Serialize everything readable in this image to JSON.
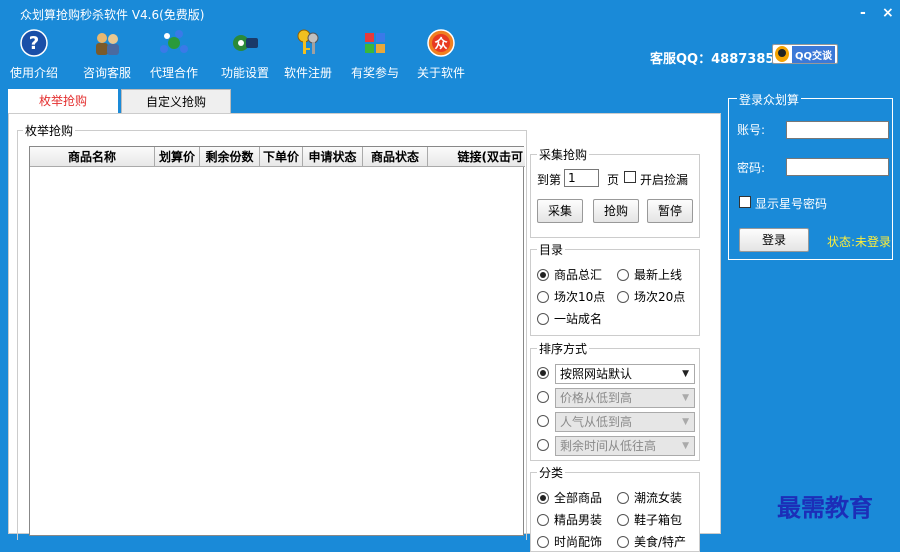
{
  "window": {
    "title": "众划算抢购秒杀软件 V4.6(免费版)",
    "minimize": "-",
    "close": "×"
  },
  "toolbar": [
    {
      "label": "使用介绍",
      "icon": "help-icon"
    },
    {
      "label": "咨询客服",
      "icon": "people-icon"
    },
    {
      "label": "代理合作",
      "icon": "network-icon"
    },
    {
      "label": "功能设置",
      "icon": "settings-icon"
    },
    {
      "label": "软件注册",
      "icon": "keys-icon"
    },
    {
      "label": "有奖参与",
      "icon": "gift-icon"
    },
    {
      "label": "关于软件",
      "icon": "about-icon"
    }
  ],
  "service": {
    "text": "客服QQ：488738580",
    "qq_button": "QQ交谈"
  },
  "tabs": [
    {
      "label": "枚举抢购"
    },
    {
      "label": "自定义抢购"
    }
  ],
  "enum_group": {
    "legend": "枚举抢购"
  },
  "grid": {
    "columns": [
      "商品名称",
      "划算价",
      "剩余份数",
      "下单价",
      "申请状态",
      "商品状态",
      "链接(双击可"
    ]
  },
  "collect": {
    "legend": "采集抢购",
    "page_prefix": "到第",
    "page_value": "1",
    "page_suffix": "页",
    "fill_label": "开启捡漏",
    "buttons": {
      "collect": "采集",
      "buy": "抢购",
      "pause": "暂停"
    }
  },
  "catalog": {
    "legend": "目录",
    "options": [
      "商品总汇",
      "最新上线",
      "场次10点",
      "场次20点",
      "一站成名"
    ],
    "selected": "商品总汇"
  },
  "sort": {
    "legend": "排序方式",
    "options": [
      "按照网站默认",
      "价格从低到高",
      "人气从低到高",
      "剩余时间从低往高"
    ],
    "selected": "按照网站默认"
  },
  "category": {
    "legend": "分类",
    "options": [
      "全部商品",
      "潮流女装",
      "精品男装",
      "鞋子箱包",
      "时尚配饰",
      "美食/特产"
    ],
    "selected": "全部商品"
  },
  "login": {
    "legend": "登录众划算",
    "account_label": "账号:",
    "password_label": "密码:",
    "show_password_label": "显示星号密码",
    "login_button": "登录",
    "status": "状态:未登录"
  },
  "watermark": "最需教育",
  "colors": {
    "accent": "#1a8ad8",
    "tab_active_text": "#e43030",
    "status_text": "#ffef3a",
    "watermark": "#1c2eb8"
  }
}
